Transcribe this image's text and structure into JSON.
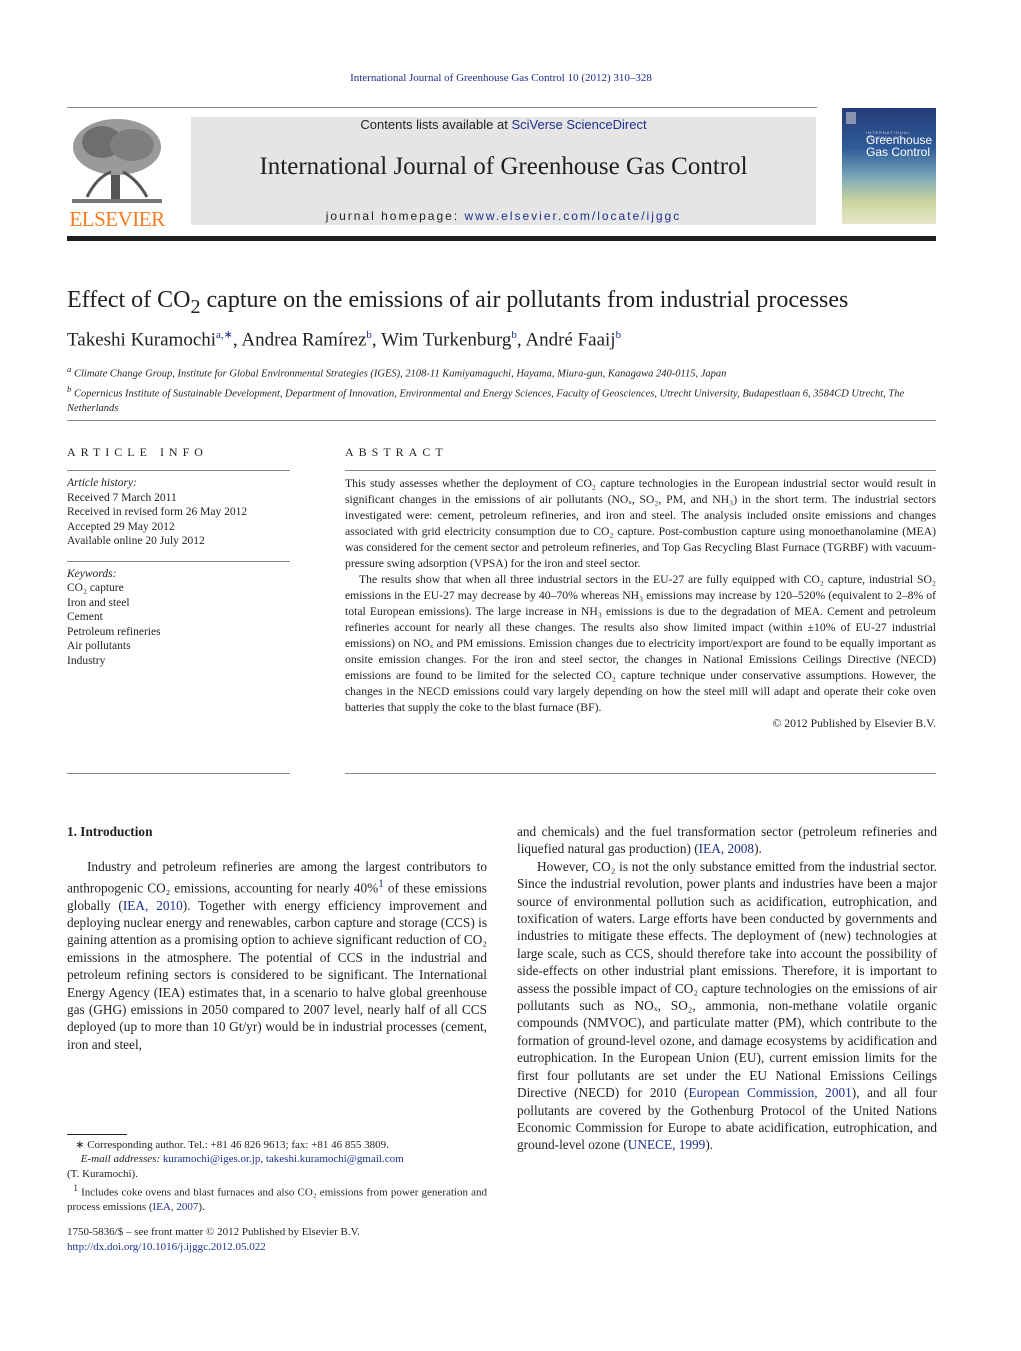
{
  "header": {
    "citation": "International Journal of Greenhouse Gas Control 10 (2012) 310–328",
    "contents_prefix": "Contents lists available at ",
    "contents_link": "SciVerse ScienceDirect",
    "journal_title": "International Journal of Greenhouse Gas Control",
    "homepage_prefix": "journal homepage: ",
    "homepage_link": "www.elsevier.com/locate/ijggc",
    "publisher_logo": "ELSEVIER",
    "cover": {
      "small": "INTERNATIONAL JOURNAL OF",
      "line1": "Greenhouse",
      "line2": "Gas Control",
      "gradient_top": "#263a78",
      "gradient_bottom": "#e8e6c8"
    }
  },
  "article": {
    "title_pre": "Effect of CO",
    "title_sub": "2",
    "title_post": " capture on the emissions of air pollutants from industrial processes",
    "authors": [
      {
        "name": "Takeshi Kuramochi",
        "aff": "a,∗"
      },
      {
        "name": "Andrea Ramírez",
        "aff": "b"
      },
      {
        "name": "Wim Turkenburg",
        "aff": "b"
      },
      {
        "name": "André Faaij",
        "aff": "b"
      }
    ],
    "affiliations": [
      {
        "mark": "a",
        "text": "Climate Change Group, Institute for Global Environmental Strategies (IGES), 2108-11 Kamiyamaguchi, Hayama, Miura-gun, Kanagawa 240-0115, Japan"
      },
      {
        "mark": "b",
        "text": "Copernicus Institute of Sustainable Development, Department of Innovation, Environmental and Energy Sciences, Faculty of Geosciences, Utrecht University, Budapestlaan 6, 3584CD Utrecht, The Netherlands"
      }
    ]
  },
  "article_info": {
    "heading": "ARTICLE INFO",
    "history_label": "Article history:",
    "history": [
      "Received 7 March 2011",
      "Received in revised form 26 May 2012",
      "Accepted 29 May 2012",
      "Available online 20 July 2012"
    ],
    "keywords_label": "Keywords:",
    "keywords": [
      "CO₂ capture",
      "Iron and steel",
      "Cement",
      "Petroleum refineries",
      "Air pollutants",
      "Industry"
    ]
  },
  "abstract": {
    "heading": "ABSTRACT",
    "p1": "This study assesses whether the deployment of CO₂ capture technologies in the European industrial sector would result in significant changes in the emissions of air pollutants (NOₓ, SO₂, PM, and NH₃) in the short term. The industrial sectors investigated were: cement, petroleum refineries, and iron and steel. The analysis included onsite emissions and changes associated with grid electricity consumption due to CO₂ capture. Post-combustion capture using monoethanolamine (MEA) was considered for the cement sector and petroleum refineries, and Top Gas Recycling Blast Furnace (TGRBF) with vacuum-pressure swing adsorption (VPSA) for the iron and steel sector.",
    "p2": "The results show that when all three industrial sectors in the EU-27 are fully equipped with CO₂ capture, industrial SO₂ emissions in the EU-27 may decrease by 40–70% whereas NH₃ emissions may increase by 120–520% (equivalent to 2–8% of total European emissions). The large increase in NH₃ emissions is due to the degradation of MEA. Cement and petroleum refineries account for nearly all these changes. The results also show limited impact (within ±10% of EU-27 industrial emissions) on NOₓ and PM emissions. Emission changes due to electricity import/export are found to be equally important as onsite emission changes. For the iron and steel sector, the changes in National Emissions Ceilings Directive (NECD) emissions are found to be limited for the selected CO₂ capture technique under conservative assumptions. However, the changes in the NECD emissions could vary largely depending on how the steel mill will adapt and operate their coke oven batteries that supply the coke to the blast furnace (BF).",
    "copyright": "© 2012 Published by Elsevier B.V."
  },
  "intro": {
    "heading": "1.  Introduction",
    "left": {
      "p1a": "Industry and petroleum refineries are among the largest contributors to anthropogenic CO₂ emissions, accounting for nearly 40%",
      "p1_sup": "1",
      "p1b": " of these emissions globally (",
      "p1_ref1": "IEA, 2010",
      "p1c": "). Together with energy efficiency improvement and deploying nuclear energy and renewables, carbon capture and storage (CCS) is gaining attention as a promising option to achieve significant reduction of CO₂ emissions in the atmosphere. The potential of CCS in the industrial and petroleum refining sectors is considered to be significant. The International Energy Agency (IEA) estimates that, in a scenario to halve global greenhouse gas (GHG) emissions in 2050 compared to 2007 level, nearly half of all CCS deployed (up to more than 10 Gt/yr) would be in industrial processes (cement, iron and steel,"
    },
    "right": {
      "p1a": "and chemicals) and the fuel transformation sector (petroleum refineries and liquefied natural gas production) (",
      "p1_ref": "IEA, 2008",
      "p1b": ").",
      "p2a": "However, CO₂ is not the only substance emitted from the industrial sector. Since the industrial revolution, power plants and industries have been a major source of environmental pollution such as acidification, eutrophication, and toxification of waters. Large efforts have been conducted by governments and industries to mitigate these effects. The deployment of (new) technologies at large scale, such as CCS, should therefore take into account the possibility of side-effects on other industrial plant emissions. Therefore, it is important to assess the possible impact of CO₂ capture technologies on the emissions of air pollutants such as NOₓ, SO₂, ammonia, non-methane volatile organic compounds (NMVOC), and particulate matter (PM), which contribute to the formation of ground-level ozone, and damage ecosystems by acidification and eutrophication. In the European Union (EU), current emission limits for the first four pollutants are set under the EU National Emissions Ceilings Directive (NECD) for 2010 (",
      "p2_ref1": "European Commission, 2001",
      "p2b": "), and all four pollutants are covered by the Gothenburg Protocol of the United Nations Economic Commission for Europe to abate acidification, eutrophication, and ground-level ozone (",
      "p2_ref2": "UNECE, 1999",
      "p2c": ")."
    }
  },
  "footnotes": {
    "corr_mark": "∗",
    "corr_text": " Corresponding author. Tel.: +81 46 826 9613; fax: +81 46 855 3809.",
    "email_label": "E-mail addresses:",
    "email1": "kuramochi@iges.or.jp",
    "email_sep": ", ",
    "email2": "takeshi.kuramochi@gmail.com",
    "email_owner": "(T. Kuramochi).",
    "fn1_mark": "1",
    "fn1_text": " Includes coke ovens and blast furnaces and also CO₂ emissions from power generation and process emissions (",
    "fn1_ref": "IEA, 2007",
    "fn1_end": ")."
  },
  "issn": {
    "line": "1750-5836/$ – see front matter © 2012 Published by Elsevier B.V.",
    "doi": "http://dx.doi.org/10.1016/j.ijggc.2012.05.022"
  }
}
